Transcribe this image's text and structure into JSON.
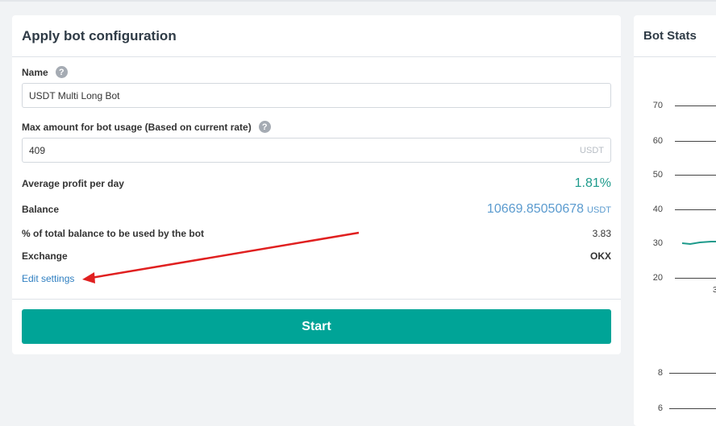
{
  "config": {
    "title": "Apply bot configuration",
    "name_label": "Name",
    "name_value": "USDT Multi Long Bot",
    "max_amount_label": "Max amount for bot usage (Based on current rate)",
    "max_amount_value": "409",
    "max_amount_unit": "USDT",
    "help_glyph": "?",
    "rows": {
      "profit_label": "Average profit per day",
      "profit_value": "1.81%",
      "balance_label": "Balance",
      "balance_value": "10669.85050678",
      "balance_unit": "USDT",
      "percent_label": "% of total balance to be used by the bot",
      "percent_value": "3.83",
      "exchange_label": "Exchange",
      "exchange_value": "OKX"
    },
    "edit_link": "Edit settings",
    "start_label": "Start"
  },
  "stats": {
    "title": "Bot Stats",
    "y_ticks": [
      "70",
      "60",
      "50",
      "40",
      "30",
      "20",
      "8",
      "6"
    ],
    "x_tick_partial": "3",
    "series_color": "#1d9a8b"
  },
  "colors": {
    "accent": "#00a497",
    "link": "#2f7fc1",
    "profit": "#1d9a8b",
    "balance": "#5b9bcf",
    "annotation_arrow": "#e02020"
  }
}
